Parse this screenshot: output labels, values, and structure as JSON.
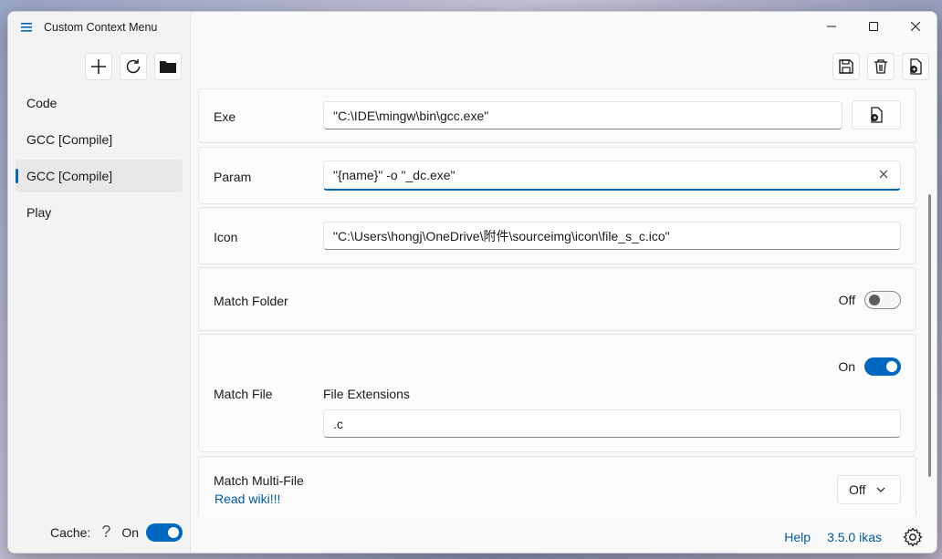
{
  "app": {
    "title": "Custom Context Menu"
  },
  "sidebar": {
    "items": [
      {
        "label": "Code"
      },
      {
        "label": "GCC [Compile]"
      },
      {
        "label": "GCC [Compile]"
      },
      {
        "label": "Play"
      }
    ],
    "selected_index": 2,
    "footer": {
      "cache_label": "Cache:",
      "help_glyph": "?",
      "toggle_state": "On"
    }
  },
  "form": {
    "exe": {
      "label": "Exe",
      "value": "\"C:\\IDE\\mingw\\bin\\gcc.exe\""
    },
    "param": {
      "label": "Param",
      "value": "\"{name}\" -o \"_dc.exe\""
    },
    "icon": {
      "label": "Icon",
      "value": "\"C:\\Users\\hongj\\OneDrive\\附件\\sourceimg\\icon\\file_s_c.ico\""
    },
    "match_folder": {
      "label": "Match Folder",
      "state": "Off"
    },
    "match_file": {
      "label": "Match File",
      "state": "On",
      "ext_label": "File Extensions",
      "ext_value": ".c"
    },
    "match_multi": {
      "label": "Match Multi-File",
      "link": "Read wiki!!!",
      "dropdown_value": "Off"
    }
  },
  "footer": {
    "help": "Help",
    "version": "3.5.0 ikas"
  },
  "colors": {
    "accent": "#0067c0",
    "link": "#005a9e"
  }
}
